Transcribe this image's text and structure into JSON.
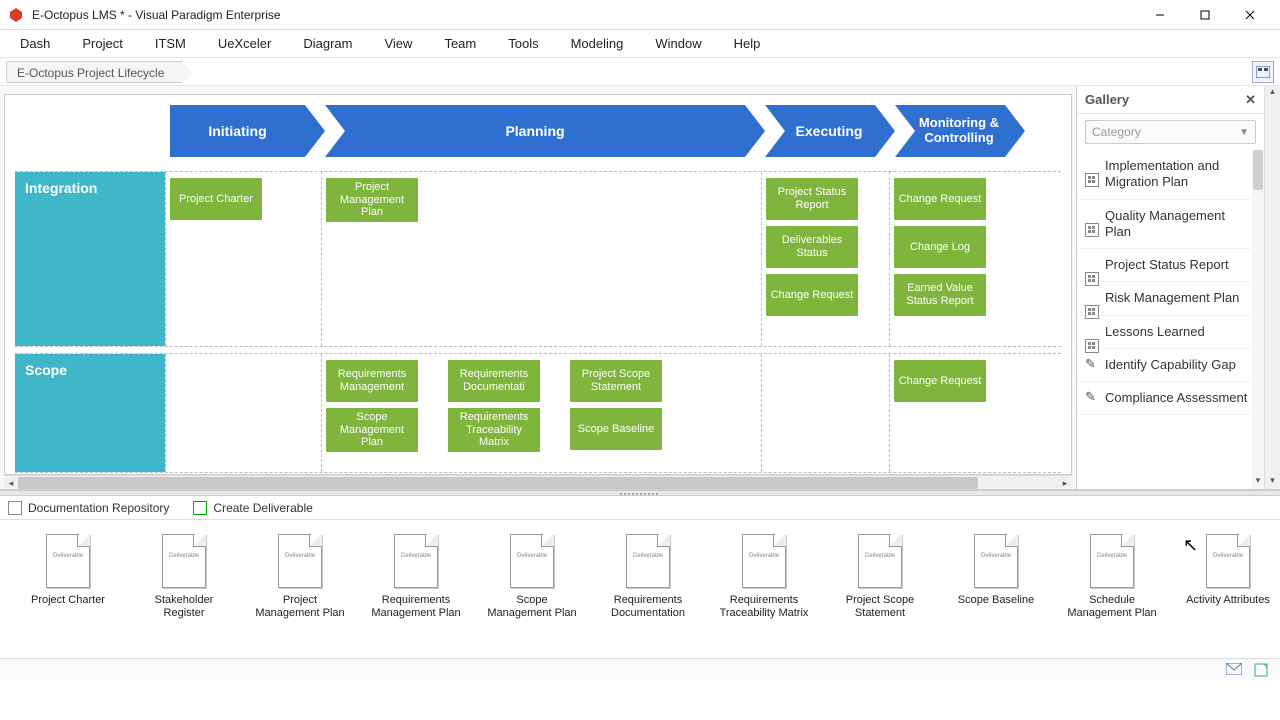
{
  "window": {
    "title": "E-Octopus LMS * - Visual Paradigm Enterprise"
  },
  "menu": [
    "Dash",
    "Project",
    "ITSM",
    "UeXceler",
    "Diagram",
    "View",
    "Team",
    "Tools",
    "Modeling",
    "Window",
    "Help"
  ],
  "breadcrumb": "E-Octopus Project Lifecycle",
  "phases": [
    "Initiating",
    "Planning",
    "Executing",
    "Monitoring & Controlling"
  ],
  "rows": {
    "r1": {
      "label": "Integration",
      "initiating": [
        "Project Charter"
      ],
      "planning": [
        "Project Management Plan"
      ],
      "executing": [
        "Project Status Report",
        "Deliverables Status",
        "Change Request"
      ],
      "monitoring": [
        "Change Request",
        "Change Log",
        "Earned Value Status Report"
      ]
    },
    "r2": {
      "label": "Scope",
      "initiating": [],
      "planning_col_a": [
        "Requirements Management",
        "Scope Management Plan"
      ],
      "planning_col_b": [
        "Requirements Documentati",
        "Requirements Traceability Matrix"
      ],
      "planning_col_c": [
        "Project Scope Statement",
        "Scope Baseline"
      ],
      "executing": [],
      "monitoring": [
        "Change Request"
      ]
    }
  },
  "gallery": {
    "title": "Gallery",
    "select_placeholder": "Category",
    "items": [
      {
        "icon": "grid",
        "label": "Implementation and Migration Plan"
      },
      {
        "icon": "grid",
        "label": "Quality Management Plan"
      },
      {
        "icon": "grid",
        "label": "Project Status Report"
      },
      {
        "icon": "grid",
        "label": "Risk Management Plan"
      },
      {
        "icon": "grid",
        "label": "Lessons Learned"
      },
      {
        "icon": "edit",
        "label": "Identify Capability Gap"
      },
      {
        "icon": "edit",
        "label": "Compliance Assessment"
      }
    ]
  },
  "bottom_tabs": {
    "repo": "Documentation Repository",
    "create": "Create Deliverable"
  },
  "deliverables": [
    "Project Charter",
    "Stakeholder Register",
    "Project Management Plan",
    "Requirements Management Plan",
    "Scope Management Plan",
    "Requirements Documentation",
    "Requirements Traceability Matrix",
    "Project Scope Statement",
    "Scope Baseline",
    "Schedule Management Plan",
    "Activity Attributes"
  ],
  "deliverable_tag": "Deliverable"
}
